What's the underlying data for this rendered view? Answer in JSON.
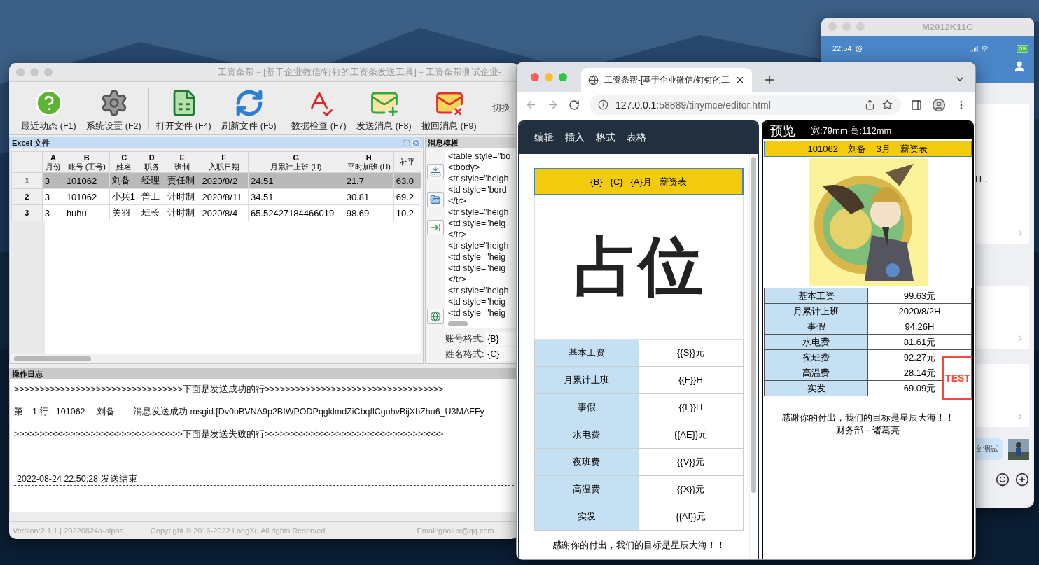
{
  "app_window": {
    "title": "工资条帮－[基于企业微信/钉钉的工资条发送工具]－工资条帮测试企业-",
    "toolbar": [
      {
        "kind": "help",
        "label": "最近动态 (F1)"
      },
      {
        "kind": "settings",
        "label": "系统设置 (F2)"
      },
      {
        "kind": "excel",
        "label": "打开文件 (F4)"
      },
      {
        "kind": "refresh",
        "label": "刷新文件 (F5)"
      },
      {
        "kind": "check",
        "label": "数据检查 (F7)"
      },
      {
        "kind": "send",
        "label": "发送消息 (F8)"
      },
      {
        "kind": "recall",
        "label": "撤回消息 (F9)"
      }
    ],
    "toolbar_extra": "切换",
    "excel_panel": {
      "title": "Excel 文件",
      "columns": [
        {
          "letter": "A",
          "name": "月份"
        },
        {
          "letter": "B",
          "name": "账号 (工号)"
        },
        {
          "letter": "C",
          "name": "姓名"
        },
        {
          "letter": "D",
          "name": "职务"
        },
        {
          "letter": "E",
          "name": "班制"
        },
        {
          "letter": "F",
          "name": "入职日期"
        },
        {
          "letter": "G",
          "name": "月累计上班 (H)"
        },
        {
          "letter": "H",
          "name": "平时加班 (H)"
        },
        {
          "name": "补平"
        }
      ],
      "rows": [
        {
          "number": "1",
          "selected": true,
          "cells": [
            "3",
            "101062",
            "刘备",
            "经理",
            "责任制",
            "2020/8/2",
            "24.51",
            "21.7",
            "63.0"
          ]
        },
        {
          "number": "2",
          "selected": false,
          "cells": [
            "3",
            "101062",
            "小兵1",
            "普工",
            "计时制",
            "2020/8/11",
            "34.51",
            "30.81",
            "69.2"
          ]
        },
        {
          "number": "3",
          "selected": false,
          "cells": [
            "3",
            "huhu",
            "关羽",
            "班长",
            "计时制",
            "2020/8/4",
            "65.52427184466019",
            "98.69",
            "10.2"
          ]
        }
      ]
    },
    "template_panel": {
      "title": "消息模板",
      "lines": [
        "<table style=\"bo",
        "<tbody>",
        "<tr style=\"heigh",
        "<td style=\"bord",
        "</tr>",
        "<tr style=\"heigh",
        "<td style=\"heig",
        "</tr>",
        "<tr style=\"heigh",
        "<td style=\"heig",
        "<td style=\"heig",
        "</tr>",
        "<tr style=\"heigh",
        "<td style=\"heig",
        "<td style=\"heig"
      ],
      "fields": [
        {
          "label": "账号格式:",
          "value": "{B}"
        },
        {
          "label": "姓名格式:",
          "value": "{C}"
        }
      ]
    },
    "log_panel": {
      "title": "操作日志",
      "lines": [
        ">>>>>>>>>>>>>>>>>>>>>>>>>>>>>>>>>下面是发送成功的行>>>>>>>>>>>>>>>>>>>>>>>>>>>>>>>>>>>",
        "第　1 行:  101062　 刘备　　消息发送成功 msgid:[Dv0oBVNA9p2BIWPODPqgklmdZiCbqflCguhvBijXbZhu6_U3MAFFy",
        ">>>>>>>>>>>>>>>>>>>>>>>>>>>>>>>>>下面是发送失败的行>>>>>>>>>>>>>>>>>>>>>>>>>>>>>>>>>>>"
      ],
      "end_line": "2022-08-24 22:50:28 发送结束"
    },
    "status_bar": [
      "Version:2.1.1 | 20220824a-alpha",
      "Copyright © 2016-2022 LongXu All rights Reserved.",
      "Email:gnolux@qq.com"
    ]
  },
  "browser": {
    "tab_title": "工资条帮-[基于企业微信/钉钉的工",
    "url_host": "127.0.0.1",
    "url_path": ":58889/tinymce/editor.html",
    "editor": {
      "menu": [
        "编辑",
        "插入",
        "格式",
        "表格"
      ],
      "heading": "{B}   {C}   {A}月   薪资表",
      "placeholder_text": "占位",
      "rows": [
        {
          "label": "基本工资",
          "value": "{{S}}元"
        },
        {
          "label": "月累计上班",
          "value": "{{F}}H"
        },
        {
          "label": "事假",
          "value": "{{L}}H"
        },
        {
          "label": "水电费",
          "value": "{{AE}}元"
        },
        {
          "label": "夜班费",
          "value": "{{V}}元"
        },
        {
          "label": "高温费",
          "value": "{{X}}元"
        },
        {
          "label": "实发",
          "value": "{{AI}}元"
        }
      ],
      "footer": "感谢你的付出，我们的目标是星辰大海！！"
    },
    "preview": {
      "title": "预览",
      "size": "宽:79mm 高:112mm",
      "heading": "101062    刘备    3月    薪资表",
      "rows": [
        {
          "label": "基本工资",
          "value": "99.63元"
        },
        {
          "label": "月累计上班",
          "value": "2020/8/2H"
        },
        {
          "label": "事假",
          "value": "94.26H"
        },
        {
          "label": "水电费",
          "value": "81.61元"
        },
        {
          "label": "夜班费",
          "value": "92.27元"
        },
        {
          "label": "高温费",
          "value": "28.14元"
        },
        {
          "label": "实发",
          "value": "69.09元"
        }
      ],
      "stamp": "TEST",
      "footer": [
        "感谢你的付出，我们的目标是星辰大海！！",
        "财务部－诸葛亮"
      ]
    }
  },
  "phone_window": {
    "title": "M2012K11C",
    "time": "22:54",
    "battery": "59",
    "chat_text": "H，",
    "bubble": "文测试"
  }
}
